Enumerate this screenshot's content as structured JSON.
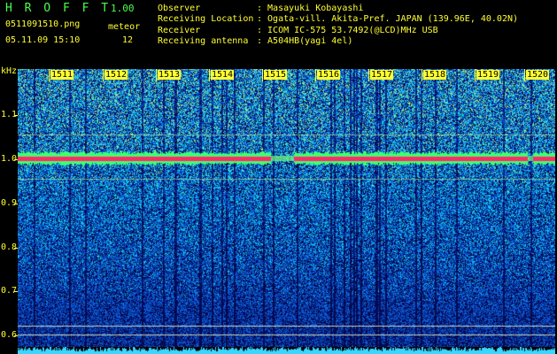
{
  "header": {
    "app_title": "H R O F F T",
    "version": "1.00",
    "filename": "0511091510.png",
    "datetime": "05.11.09 15:10",
    "meteor_label": "meteor",
    "meteor_count": "12"
  },
  "info": {
    "observer_label": "Observer",
    "observer_value": ": Masayuki Kobayashi",
    "location_label": "Receiving Location",
    "location_value": ": Ogata-vill. Akita-Pref. JAPAN (139.96E, 40.02N)",
    "receiver_label": "Receiver",
    "receiver_value": ": ICOM IC-575 53.7492(@LCD)MHz USB",
    "antenna_label": "Receiving antenna",
    "antenna_value": ": A504HB(yagi 4el)"
  },
  "axis": {
    "unit": "kHz",
    "y_ticks": [
      "1.1",
      "1.0",
      "0.9",
      "0.8",
      "0.7",
      "0.6"
    ],
    "x_ticks": [
      "1511",
      "1512",
      "1513",
      "1514",
      "1515",
      "1516",
      "1517",
      "1518",
      "1519",
      "1520"
    ]
  },
  "colors": {
    "background": "#000000",
    "header_green": "#4cff4c",
    "header_yellow": "#ffff33",
    "spectrum_low": "#0a1a6e",
    "spectrum_mid": "#1e6cff",
    "spectrum_high": "#40ff60",
    "signal": "#ff2a6a"
  }
}
